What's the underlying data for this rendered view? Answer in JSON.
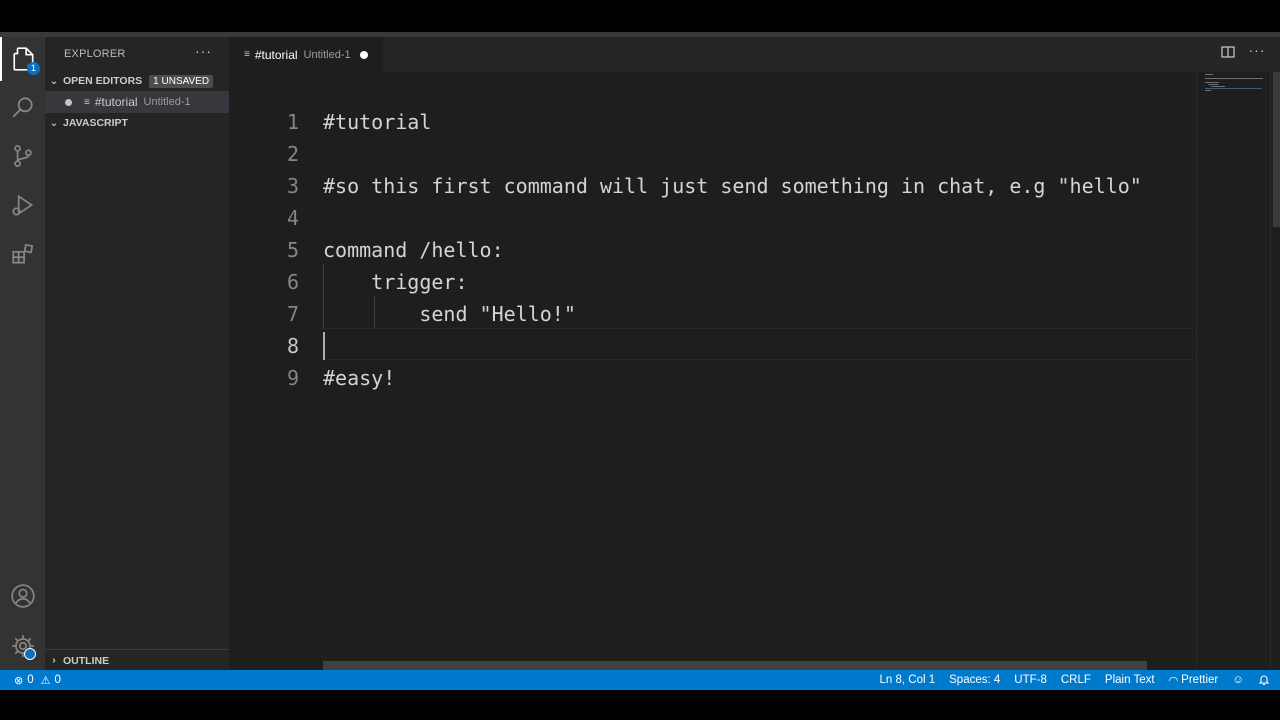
{
  "sidebar": {
    "title": "EXPLORER",
    "more_label": "···",
    "open_editors": {
      "label": "OPEN EDITORS",
      "badge": "1 UNSAVED",
      "file_name": "#tutorial",
      "file_desc": "Untitled-1"
    },
    "folder_label": "JAVASCRIPT",
    "outline_label": "OUTLINE"
  },
  "activity": {
    "explorer_badge": "1",
    "icons": [
      "files-icon",
      "search-icon",
      "source-control-icon",
      "run-debug-icon",
      "extensions-icon",
      "account-icon",
      "settings-gear-icon"
    ]
  },
  "tab": {
    "name": "#tutorial",
    "desc": "Untitled-1"
  },
  "editor": {
    "line_numbers": [
      "1",
      "2",
      "3",
      "4",
      "5",
      "6",
      "7",
      "8",
      "9"
    ],
    "current_line": 8,
    "lines": [
      "#tutorial",
      "",
      "#so this first command will just send something in chat, e.g \"hello\"",
      "",
      "command /hello:",
      "    trigger:",
      "        send \"Hello!\"",
      "",
      "#easy!"
    ]
  },
  "statusbar": {
    "errors": "0",
    "warnings": "0",
    "position": "Ln 8, Col 1",
    "spaces": "Spaces: 4",
    "encoding": "UTF-8",
    "eol": "CRLF",
    "language": "Plain Text",
    "formatter": "Prettier"
  },
  "colors": {
    "accent": "#007acc",
    "editor_bg": "#1e1e1e",
    "sidebar_bg": "#252526",
    "activity_bg": "#333333"
  }
}
